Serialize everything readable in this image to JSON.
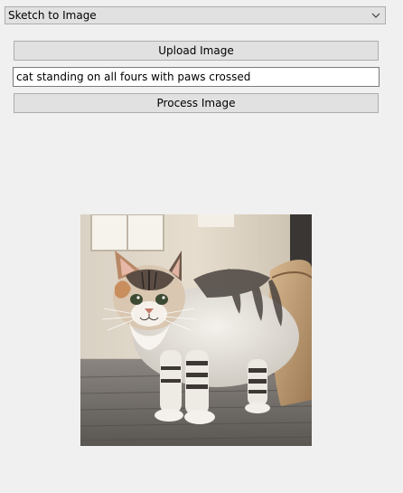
{
  "mode_select": {
    "selected": "Sketch to Image",
    "chevron_icon": "chevron-down-icon"
  },
  "buttons": {
    "upload_label": "Upload Image",
    "process_label": "Process Image"
  },
  "prompt_field": {
    "value": "cat standing on all fours with paws crossed"
  },
  "result_image": {
    "subject": "tabby-and-white kitten standing on a rug indoors"
  },
  "colors": {
    "window_bg": "#f0f0f0",
    "button_bg": "#e1e1e1",
    "button_border": "#adadad",
    "field_border": "#7a7a7a"
  }
}
